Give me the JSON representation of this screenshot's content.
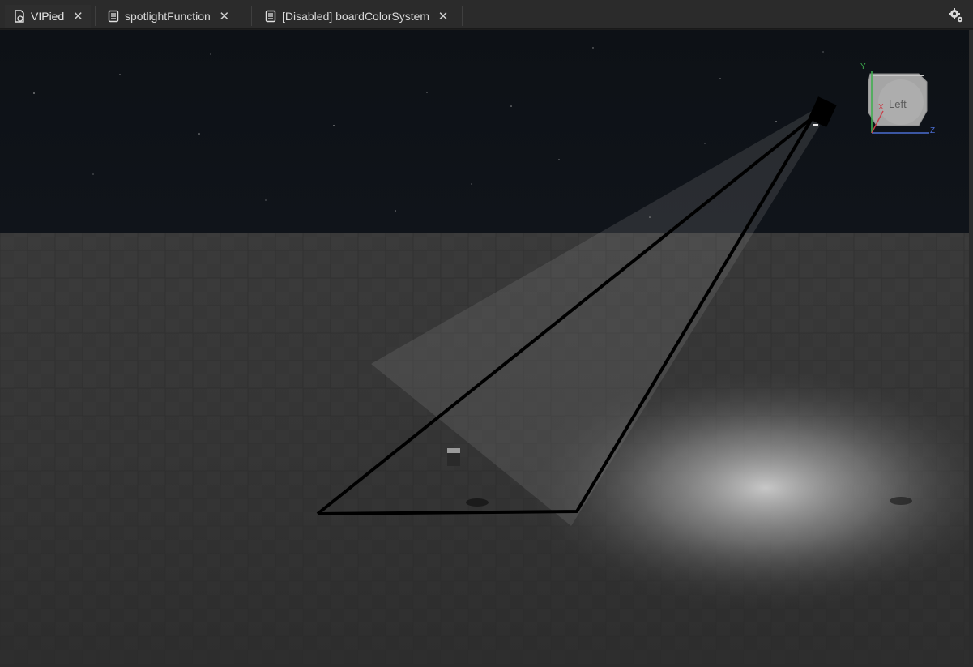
{
  "tabs": [
    {
      "label": "VIPied",
      "icon": "script-document-icon",
      "active": true
    },
    {
      "label": "spotlightFunction",
      "icon": "document-icon",
      "active": false
    },
    {
      "label": "[Disabled] boardColorSystem",
      "icon": "document-icon",
      "active": false
    }
  ],
  "toolbar": {
    "settings_icon": "gear-settings-icon"
  },
  "view_cube": {
    "face_label": "Left",
    "axis_y": "Y",
    "axis_x": "X",
    "axis_z": "Z"
  },
  "colors": {
    "sky": "#0c0f13",
    "ground": "#3a3a3a",
    "axis_y": "#3fae4f",
    "axis_x": "#c8404a",
    "axis_z": "#4a6cd0"
  }
}
